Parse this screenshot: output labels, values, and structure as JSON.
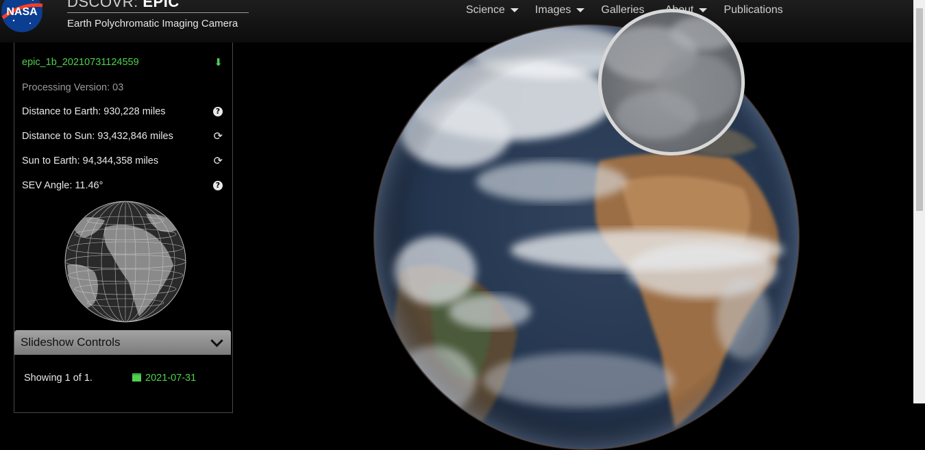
{
  "header": {
    "site_title_light": "DSCOVR: ",
    "site_title_bold": "EPIC",
    "subtitle": "Earth Polychromatic Imaging Camera",
    "logo_text": "NASA",
    "nav": [
      {
        "label": "Science",
        "dropdown": true
      },
      {
        "label": "Images",
        "dropdown": true
      },
      {
        "label": "Galleries",
        "dropdown": false
      },
      {
        "label": "About",
        "dropdown": true
      },
      {
        "label": "Publications",
        "dropdown": false
      }
    ]
  },
  "panel": {
    "image_name": "epic_1b_20210731124559",
    "processing_version": "Processing Version: 03",
    "distance_earth": "Distance to Earth: 930,228 miles",
    "distance_sun": "Distance to Sun: 93,432,846 miles",
    "sun_to_earth": "Sun to Earth: 94,344,358 miles",
    "sev_angle": "SEV Angle: 11.46°"
  },
  "slideshow": {
    "title": "Slideshow Controls",
    "showing": "Showing 1 of 1.",
    "date": "2021-07-31"
  },
  "colors": {
    "accent_green": "#4fd14f",
    "header_bg": "#161616",
    "panel_header": "#8f8f8f"
  },
  "icons": {
    "download": "download-icon",
    "help": "question-circle-icon",
    "refresh": "refresh-icon",
    "calendar": "calendar-icon",
    "chevron": "chevron-down-icon"
  }
}
